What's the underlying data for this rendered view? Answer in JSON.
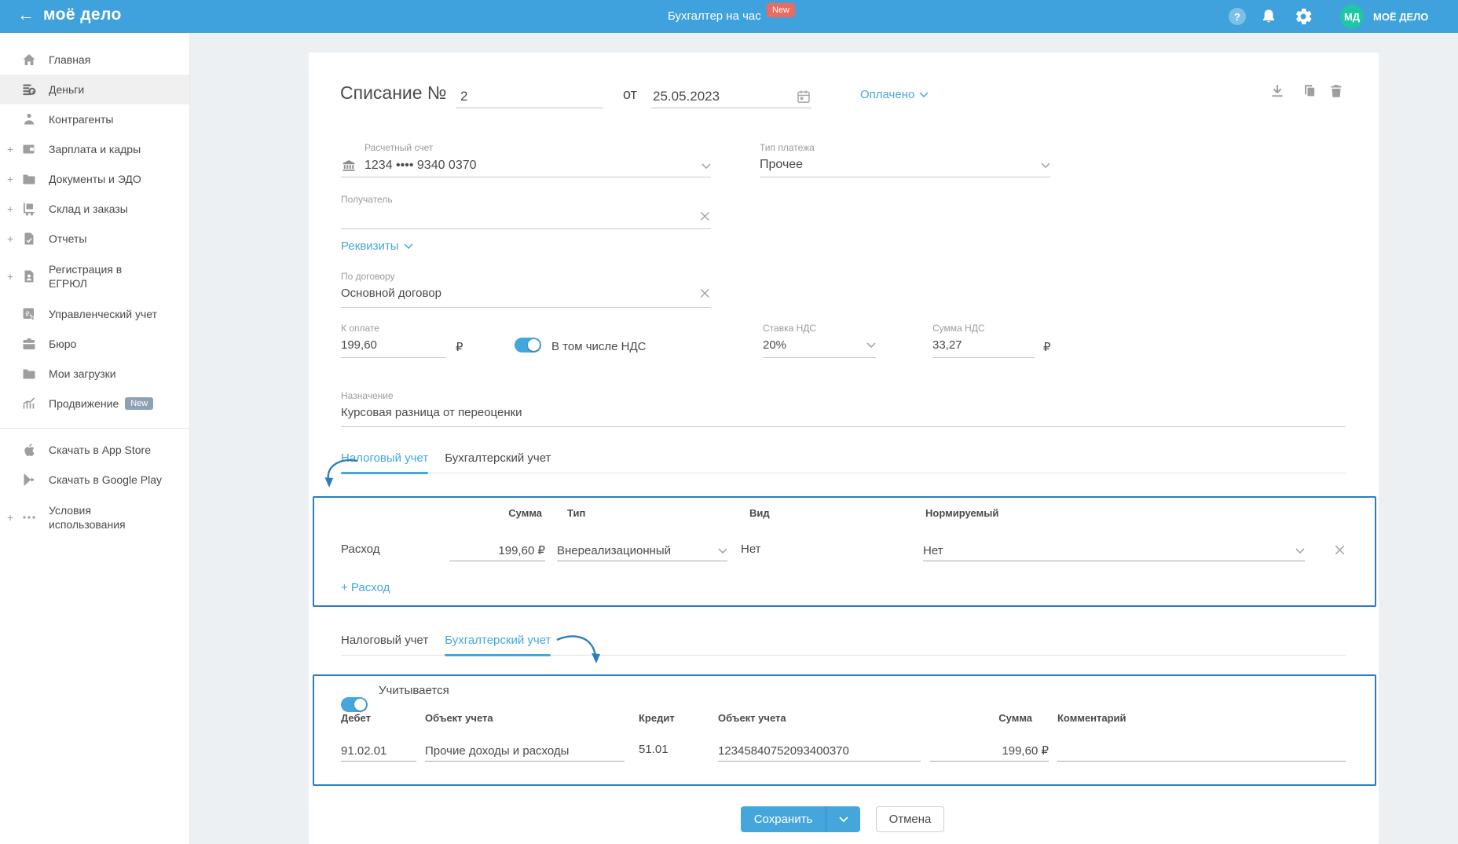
{
  "colors": {
    "header_blue": "#3FA2DC",
    "accent_blue": "#45A6DC",
    "annotation_blue": "#2E7CC0",
    "badge_red": "#EB6C5E",
    "avatar_green": "#1FC8A5",
    "badge_gray": "#8DA1B4"
  },
  "header": {
    "logo": "моё дело",
    "promo_label": "Бухгалтер на час",
    "promo_badge": "New",
    "avatar_initials": "МД",
    "account_name": "МОЁ ДЕЛО"
  },
  "sidebar": {
    "items": [
      {
        "label": "Главная"
      },
      {
        "label": "Деньги"
      },
      {
        "label": "Контрагенты"
      },
      {
        "label": "Зарплата и кадры"
      },
      {
        "label": "Документы и ЭДО"
      },
      {
        "label": "Склад и заказы"
      },
      {
        "label": "Отчеты"
      },
      {
        "label": "Регистрация в ЕГРЮЛ"
      },
      {
        "label": "Управленческий учет"
      },
      {
        "label": "Бюро"
      },
      {
        "label": "Мои загрузки"
      },
      {
        "label": "Продвижение",
        "badge": "New"
      },
      {
        "label": "Скачать в App Store"
      },
      {
        "label": "Скачать в Google Play"
      },
      {
        "label": "Условия использования"
      }
    ]
  },
  "doc": {
    "title": "Списание №",
    "number": "2",
    "of": "от",
    "date": "25.05.2023",
    "status": "Оплачено",
    "account_label": "Расчетный счет",
    "account_value": "1234 •••• 9340 0370",
    "payment_type_label": "Тип платежа",
    "payment_type_value": "Прочее",
    "recipient_label": "Получатель",
    "recipient_value": "",
    "requisites_link": "Реквизиты",
    "contract_label": "По договору",
    "contract_value": "Основной договор",
    "amount_label": "К оплате",
    "amount_value": "199,60",
    "currency": "₽",
    "vat_toggle_label": "В том числе НДС",
    "vat_rate_label": "Ставка НДС",
    "vat_rate_value": "20%",
    "vat_sum_label": "Сумма НДС",
    "vat_sum_value": "33,27",
    "purpose_label": "Назначение",
    "purpose_value": "Курсовая разница от переоценки"
  },
  "tabs": {
    "tax": "Налоговый учет",
    "accounting": "Бухгалтерский учет"
  },
  "tax_section": {
    "col_sum": "Сумма",
    "col_type": "Тип",
    "col_kind": "Вид",
    "col_normalized": "Нормируемый",
    "row_label": "Расход",
    "row_sum": "199,60 ₽",
    "row_type": "Внереализационный",
    "row_kind": "Нет",
    "row_normalized": "Нет",
    "add_link": "+ Расход"
  },
  "accounting_section": {
    "toggle_label": "Учитывается",
    "col_debit": "Дебет",
    "col_debit_object": "Объект учета",
    "col_credit": "Кредит",
    "col_credit_object": "Объект учета",
    "col_sum": "Сумма",
    "col_comment": "Комментарий",
    "row_debit": "91.02.01",
    "row_debit_object": "Прочие доходы и расходы",
    "row_credit": "51.01",
    "row_credit_object": "12345840752093400370",
    "row_sum": "199,60 ₽",
    "row_comment": ""
  },
  "actions": {
    "save": "Сохранить",
    "cancel": "Отмена"
  }
}
